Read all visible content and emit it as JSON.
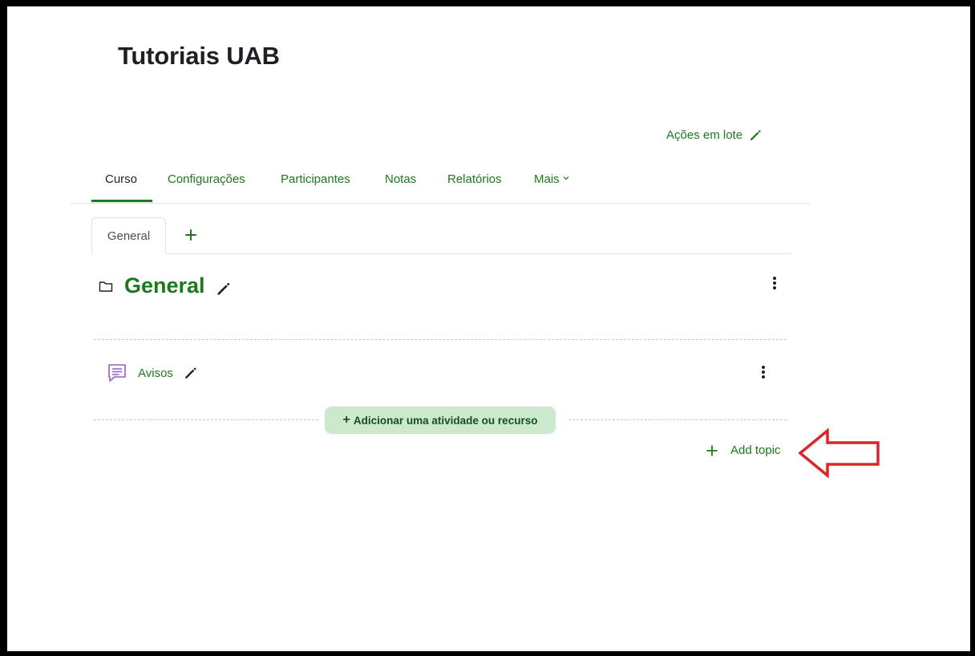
{
  "course": {
    "title": "Tutoriais UAB"
  },
  "bulk_actions": {
    "label": "Ações em lote",
    "icon": "pencil-icon"
  },
  "nav": {
    "items": [
      {
        "label": "Curso",
        "active": true
      },
      {
        "label": "Configurações"
      },
      {
        "label": "Participantes"
      },
      {
        "label": "Notas"
      },
      {
        "label": "Relatórios"
      },
      {
        "label": "Mais"
      }
    ]
  },
  "subtabs": {
    "general_label": "General",
    "add_icon": "plus-icon"
  },
  "section": {
    "title": "General",
    "icon": "folder-icon"
  },
  "activity": {
    "name": "Avisos",
    "icon": "forum-icon"
  },
  "add_activity": {
    "label": "Adicionar uma atividade ou recurso"
  },
  "add_topic": {
    "label": "Add topic"
  },
  "colors": {
    "brand_green": "#1b7a1b",
    "add_activity_bg": "#cde9cd",
    "annotation_red": "#d9262b",
    "forum_purple": "#9b59d0"
  }
}
